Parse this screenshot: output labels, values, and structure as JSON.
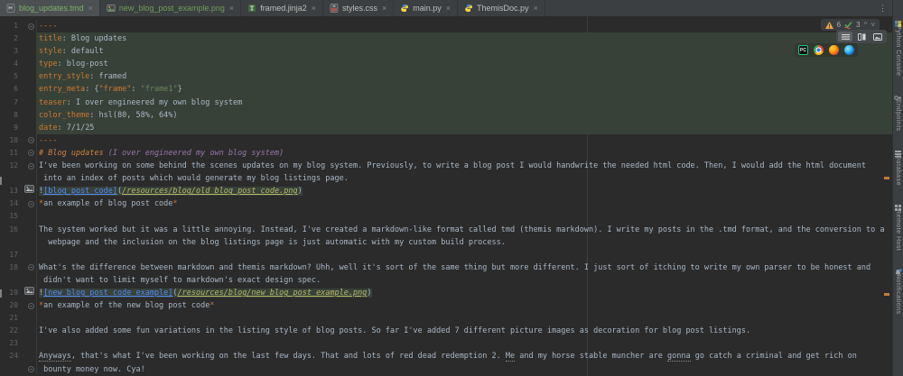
{
  "window": {
    "app": "PyCharm editor"
  },
  "colors": {
    "editor_bg": "#2b2b2b",
    "tabbar_bg": "#3c3f41",
    "frontmatter_bg": "#374138",
    "keyword_orange": "#cc7832",
    "string_green": "#6a8759",
    "link_blue": "#548af7",
    "path_olive": "#b8b96a",
    "heading_purple": "#9876aa",
    "warning_mark_orange": "#c07f33",
    "added_file_green": "#6f9d57"
  },
  "tabs": [
    {
      "label": "blog_updates.tmd",
      "icon": "tmd-file-icon",
      "active": true,
      "color": "green",
      "close": "×"
    },
    {
      "label": "new_blog_post_example.png",
      "icon": "image-file-icon",
      "active": false,
      "color": "green",
      "close": "×"
    },
    {
      "label": "framed.jinja2",
      "icon": "jinja-file-icon",
      "active": false,
      "color": "gray",
      "close": "×"
    },
    {
      "label": "styles.css",
      "icon": "css-file-icon",
      "active": false,
      "color": "gray",
      "close": "×"
    },
    {
      "label": "main.py",
      "icon": "python-file-icon",
      "active": false,
      "color": "gray",
      "close": "×"
    },
    {
      "label": "ThemisDoc.py",
      "icon": "python-file-icon",
      "active": false,
      "color": "gray",
      "close": "×"
    }
  ],
  "inspections": {
    "warning_count": "6",
    "typo_count": "3",
    "prev": "^",
    "next": "˅"
  },
  "toolbar": {
    "view_modes": [
      {
        "name": "editor-only",
        "selected": true
      },
      {
        "name": "editor-and-preview",
        "selected": false
      },
      {
        "name": "preview-only",
        "selected": false
      }
    ],
    "browsers": [
      "pycharm",
      "chrome",
      "firefox",
      "edge"
    ]
  },
  "tool_stripe": [
    {
      "label": "Python Console",
      "icon": "python-icon"
    },
    {
      "label": "Endpoints",
      "icon": "endpoints-icon"
    },
    {
      "label": "Database",
      "icon": "database-icon"
    },
    {
      "label": "Remote Host",
      "icon": "remote-host-icon"
    },
    {
      "label": "Notifications",
      "icon": "notifications-icon",
      "badge": true
    }
  ],
  "editor": {
    "rows": [
      {
        "n": "1",
        "fold": true,
        "seg": [
          [
            "dash",
            "----"
          ]
        ]
      },
      {
        "n": "2",
        "bg": "fm",
        "seg": [
          [
            "key",
            "title"
          ],
          [
            "plain",
            ": Blog updates"
          ]
        ]
      },
      {
        "n": "3",
        "bg": "fm",
        "seg": [
          [
            "key",
            "style"
          ],
          [
            "plain",
            ": default"
          ]
        ]
      },
      {
        "n": "4",
        "bg": "fm",
        "seg": [
          [
            "key",
            "type"
          ],
          [
            "plain",
            ": blog-post"
          ]
        ]
      },
      {
        "n": "5",
        "bg": "fm",
        "seg": [
          [
            "key",
            "entry_style"
          ],
          [
            "plain",
            ": framed"
          ]
        ]
      },
      {
        "n": "6",
        "bg": "fm",
        "seg": [
          [
            "key",
            "entry_meta"
          ],
          [
            "plain",
            ": {"
          ],
          [
            "key",
            "\"frame\""
          ],
          [
            "plain",
            ": "
          ],
          [
            "str",
            "\"frame1\""
          ],
          [
            "plain",
            "}"
          ]
        ]
      },
      {
        "n": "7",
        "bg": "fm",
        "seg": [
          [
            "key",
            "teaser"
          ],
          [
            "plain",
            ": I over engineered my own blog system"
          ]
        ]
      },
      {
        "n": "8",
        "bg": "fm",
        "seg": [
          [
            "key",
            "color_theme"
          ],
          [
            "plain",
            ": hsl(80, 58%, 64%)"
          ]
        ]
      },
      {
        "n": "9",
        "bg": "fm",
        "seg": [
          [
            "key",
            "date"
          ],
          [
            "plain",
            ": 7/1/25"
          ]
        ]
      },
      {
        "n": "10",
        "fold": true,
        "seg": [
          [
            "dash",
            "----"
          ]
        ]
      },
      {
        "n": "11",
        "fold": true,
        "seg": [
          [
            "h1",
            "# Blog updates "
          ],
          [
            "h1p",
            "(I over engineered my own blog system)"
          ]
        ]
      },
      {
        "n": "12",
        "fold": true,
        "seg": [
          [
            "plain",
            "I've been working on some behind the scenes updates on my blog system. Previously, to write a blog post I would handwrite the needed html code. Then, I would add the html document"
          ]
        ]
      },
      {
        "n": "",
        "seg": [
          [
            "plain",
            " into an index of posts which would generate my blog listings page."
          ]
        ]
      },
      {
        "n": "13",
        "icon": "image",
        "bg": "frag",
        "seg": [
          [
            "plain",
            "!"
          ],
          [
            "link",
            "[blog post code]"
          ],
          [
            "plain",
            "("
          ],
          [
            "path",
            "/resources/blog/old_blog_post_code.png"
          ],
          [
            "plain",
            ")"
          ]
        ]
      },
      {
        "n": "14",
        "fold": true,
        "seg": [
          [
            "star",
            "*"
          ],
          [
            "plain",
            "an example of blog post code"
          ],
          [
            "star",
            "*"
          ]
        ]
      },
      {
        "n": "15",
        "seg": []
      },
      {
        "n": "16",
        "seg": [
          [
            "plain",
            "The system worked but it was a little annoying. Instead, I've created a markdown-like format called tmd (themis markdown). I write my posts in the .tmd format, and the conversion to a"
          ]
        ]
      },
      {
        "n": "",
        "seg": [
          [
            "plain",
            "  webpage and the inclusion on the blog listings page is just automatic with my custom build process."
          ]
        ]
      },
      {
        "n": "17",
        "seg": []
      },
      {
        "n": "18",
        "fold": true,
        "seg": [
          [
            "plain",
            "What's the difference between markdown and themis markdown? Uhh, well it's sort of the same thing but more different. I just sort of itching to write my own parser to be honest and"
          ]
        ]
      },
      {
        "n": "",
        "seg": [
          [
            "plain",
            " didn't want to limit myself to markdown's exact design spec."
          ]
        ]
      },
      {
        "n": "19",
        "icon": "image",
        "bg": "frag",
        "seg": [
          [
            "plain",
            "!"
          ],
          [
            "link",
            "[new blog post code example]"
          ],
          [
            "plain",
            "("
          ],
          [
            "path",
            "/resources/blog/new_blog_post_example.png"
          ],
          [
            "plain",
            ")"
          ]
        ]
      },
      {
        "n": "20",
        "fold": true,
        "seg": [
          [
            "star",
            "*"
          ],
          [
            "plain",
            "an example of the new blog post code"
          ],
          [
            "star",
            "*"
          ]
        ]
      },
      {
        "n": "21",
        "seg": []
      },
      {
        "n": "22",
        "seg": [
          [
            "plain",
            "I've also added some fun variations in the listing style of blog posts. So far I've added 7 different picture images as decoration for blog post listings."
          ]
        ]
      },
      {
        "n": "23",
        "seg": []
      },
      {
        "n": "24",
        "seg": [
          [
            "typo",
            "Anyways"
          ],
          [
            "plain",
            ", that's what I've been working on the last few days. That and lots of red dead redemption 2. "
          ],
          [
            "typo",
            "Me"
          ],
          [
            "plain",
            " and my horse stable muncher are "
          ],
          [
            "typo",
            "gonna"
          ],
          [
            "plain",
            " go catch a criminal and get rich on"
          ]
        ]
      },
      {
        "n": "",
        "fold": true,
        "seg": [
          [
            "plain",
            " bounty money now. Cya!"
          ]
        ]
      }
    ]
  }
}
